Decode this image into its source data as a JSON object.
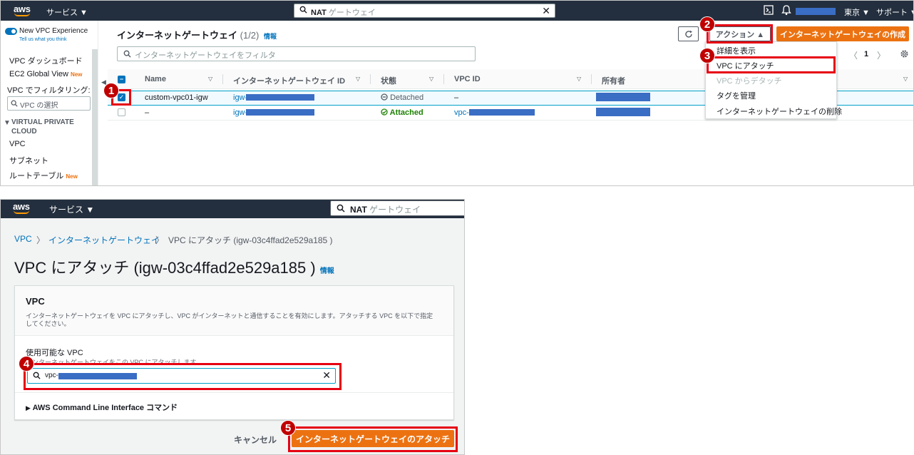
{
  "top": {
    "nav": {
      "services": "サービス ▼",
      "search_query": "NAT",
      "search_placeholder": "ゲートウェイ",
      "region": "東京 ▼",
      "support": "サポート ▼"
    },
    "sidebar": {
      "new_experience": "New VPC Experience",
      "tell_us": "Tell us what you think",
      "items": [
        "VPC ダッシュボード",
        "EC2 Global View",
        "VPC でフィルタリング:"
      ],
      "new_badge": "New",
      "vpc_select_placeholder": "VPC の選択",
      "section": [
        "VIRTUAL PRIVATE",
        "CLOUD"
      ],
      "section_items": [
        "VPC",
        "サブネット",
        "ルートテーブル"
      ]
    },
    "main": {
      "title": "インターネットゲートウェイ",
      "count": "(1/2)",
      "info": "情報",
      "actions_button": "アクション ▲",
      "create_button": "インターネットゲートウェイの作成",
      "filter_placeholder": "インターネットゲートウェイをフィルタ",
      "page_number": "1",
      "columns": [
        "Name",
        "インターネットゲートウェイ ID",
        "状態",
        "VPC ID",
        "所有者"
      ],
      "rows": [
        {
          "name": "custom-vpc01-igw",
          "id": "igw-",
          "state": "Detached",
          "vpc": "–"
        },
        {
          "name": "–",
          "id": "igw-",
          "state": "Attached",
          "vpc": "vpc-"
        }
      ],
      "menu": [
        "詳細を表示",
        "VPC にアタッチ",
        "VPC からデタッチ",
        "タグを管理",
        "インターネットゲートウェイの削除"
      ]
    },
    "markers": [
      "1",
      "2",
      "3"
    ]
  },
  "bottom": {
    "nav": {
      "services": "サービス ▼",
      "search_query": "NAT",
      "search_placeholder": "ゲートウェイ"
    },
    "breadcrumb": [
      "VPC",
      "インターネットゲートウェイ",
      "VPC にアタッチ (igw-03c4ffad2e529a185 )"
    ],
    "title": "VPC にアタッチ (igw-03c4ffad2e529a185 )",
    "info": "情報",
    "card": {
      "heading": "VPC",
      "description_1": "インターネットゲートウェイを VPC にアタッチし、VPC がインターネットと通信することを有効にします。アタッチする VPC を以下で指定",
      "description_2": "してください。",
      "field_label": "使用可能な VPC",
      "field_hint": "インターネットゲートウェイをこの VPC にアタッチします。",
      "field_value": "vpc-",
      "cli_section": "AWS Command Line Interface コマンド"
    },
    "cancel_button": "キャンセル",
    "attach_button": "インターネットゲートウェイのアタッチ",
    "markers": [
      "4",
      "5"
    ]
  },
  "colors": {
    "nav_bg": "#232f3e",
    "aws_orange": "#ec7211",
    "link_blue": "#0073bb",
    "annotation_red": "#e60012",
    "redaction_blue": "#3a6dc4",
    "status_green": "#1d8102"
  }
}
